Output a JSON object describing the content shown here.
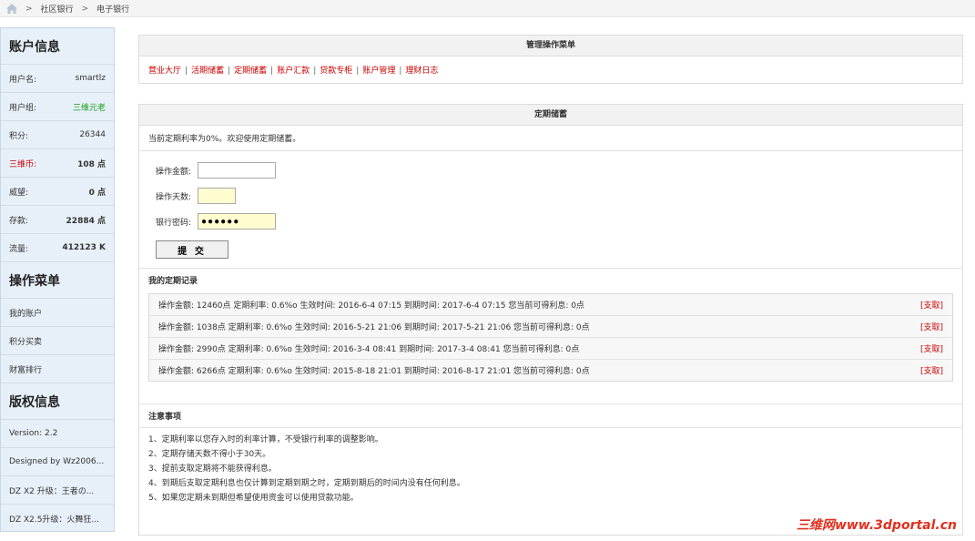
{
  "breadcrumb": {
    "sep": ">",
    "items": [
      "社区银行",
      "电子银行"
    ]
  },
  "sidebar": {
    "account_title": "账户信息",
    "account_rows": [
      {
        "label": "用户名:",
        "value": "smartlz",
        "style": "normal"
      },
      {
        "label": "用户组:",
        "value": "三维元老",
        "style": "green"
      },
      {
        "label": "积分:",
        "value": "26344",
        "style": "normal"
      },
      {
        "label": "三维币:",
        "value": "108 点",
        "style": "bold",
        "label_red": true
      },
      {
        "label": "威望:",
        "value": "0 点",
        "style": "bold"
      },
      {
        "label": "存款:",
        "value": "22884 点",
        "style": "bold"
      },
      {
        "label": "流量:",
        "value": "412123 K",
        "style": "bold"
      }
    ],
    "menu_title": "操作菜单",
    "menu_items": [
      "我的账户",
      "积分买卖",
      "财富排行"
    ],
    "copyright_title": "版权信息",
    "copyright_rows": [
      "Version: 2.2",
      "Designed by Wz2006...",
      "DZ X2 升级：王者の...",
      "DZ X2.5升级：火舞狂..."
    ]
  },
  "menu_panel": {
    "title": "管理操作菜单",
    "links": [
      "营业大厅",
      "活期储蓄",
      "定期储蓄",
      "账户汇款",
      "贷款专柜",
      "账户管理",
      "理财日志"
    ]
  },
  "fixed_panel": {
    "title": "定期储蓄",
    "notice": "当前定期利率为0%。欢迎使用定期储蓄。",
    "form": {
      "amount_label": "操作金额:",
      "amount_value": "",
      "days_label": "操作天数:",
      "days_value": "",
      "password_label": "银行密码:",
      "password_value": "●●●●●●",
      "submit_label": "提 交"
    },
    "records_title": "我的定期记录",
    "records": [
      {
        "text": "操作金额: 12460点    定期利率: 0.6%o    生效时间: 2016-6-4 07:15    到期时间: 2017-6-4 07:15    您当前可得利息: 0点",
        "action": "[支取]"
      },
      {
        "text": "操作金额: 1038点    定期利率: 0.6%o    生效时间: 2016-5-21 21:06    到期时间: 2017-5-21 21:06    您当前可得利息: 0点",
        "action": "[支取]"
      },
      {
        "text": "操作金额: 2990点    定期利率: 0.6%o    生效时间: 2016-3-4 08:41    到期时间: 2017-3-4 08:41    您当前可得利息: 0点",
        "action": "[支取]"
      },
      {
        "text": "操作金额: 6266点    定期利率: 0.6%o    生效时间: 2015-8-18 21:01    到期时间: 2016-8-17 21:01    您当前可得利息: 0点",
        "action": "[支取]"
      }
    ],
    "notes_title": "注意事项",
    "notes": [
      "1、定期利率以您存入时的利率计算，不受银行利率的调整影响。",
      "2、定期存储天数不得小于30天。",
      "3、提前支取定期将不能获得利息。",
      "4、到期后支取定期利息也仅计算到定期到期之时，定期到期后的时间内没有任何利息。",
      "5、如果您定期未到期但希望使用资金可以使用贷款功能。"
    ]
  },
  "watermark": {
    "cn": "三维网",
    "en": "www.3dportal.cn"
  }
}
